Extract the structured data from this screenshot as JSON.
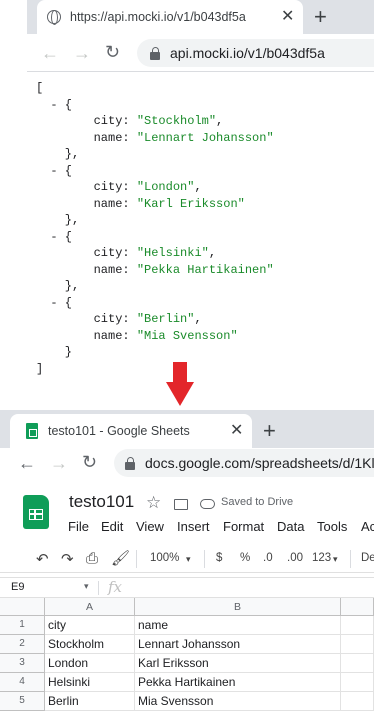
{
  "top_browser": {
    "tab_title": "https://api.mocki.io/v1/b043df5a",
    "url": "api.mocki.io/v1/b043df5a",
    "json_records": [
      {
        "city": "Stockholm",
        "name": "Lennart Johansson"
      },
      {
        "city": "London",
        "name": "Karl Eriksson"
      },
      {
        "city": "Helsinki",
        "name": "Pekka Hartikainen"
      },
      {
        "city": "Berlin",
        "name": "Mia Svensson"
      }
    ]
  },
  "bottom_browser": {
    "tab_title": "testo101 - Google Sheets",
    "url": "docs.google.com/spreadsheets/d/1Kl",
    "doc_title": "testo101",
    "saved_status": "Saved to Drive",
    "menu": [
      "File",
      "Edit",
      "View",
      "Insert",
      "Format",
      "Data",
      "Tools",
      "Ac"
    ],
    "toolbar": {
      "zoom": "100%",
      "currency": "$",
      "percent": "%",
      "dec_less": ".0",
      "dec_more": ".00",
      "number_format": "123",
      "font": "De"
    },
    "name_box": "E9",
    "fx": "fx",
    "columns": [
      "A",
      "B"
    ],
    "rows": [
      {
        "num": "1",
        "a": "city",
        "b": "name"
      },
      {
        "num": "2",
        "a": "Stockholm",
        "b": "Lennart Johansson"
      },
      {
        "num": "3",
        "a": "London",
        "b": "Karl Eriksson"
      },
      {
        "num": "4",
        "a": "Helsinki",
        "b": "Pekka Hartikainen"
      },
      {
        "num": "5",
        "a": "Berlin",
        "b": "Mia Svensson"
      }
    ]
  },
  "colors": {
    "arrow": "#e3262a",
    "sheets_green": "#0f9d58",
    "json_string": "#1a8b2a"
  }
}
